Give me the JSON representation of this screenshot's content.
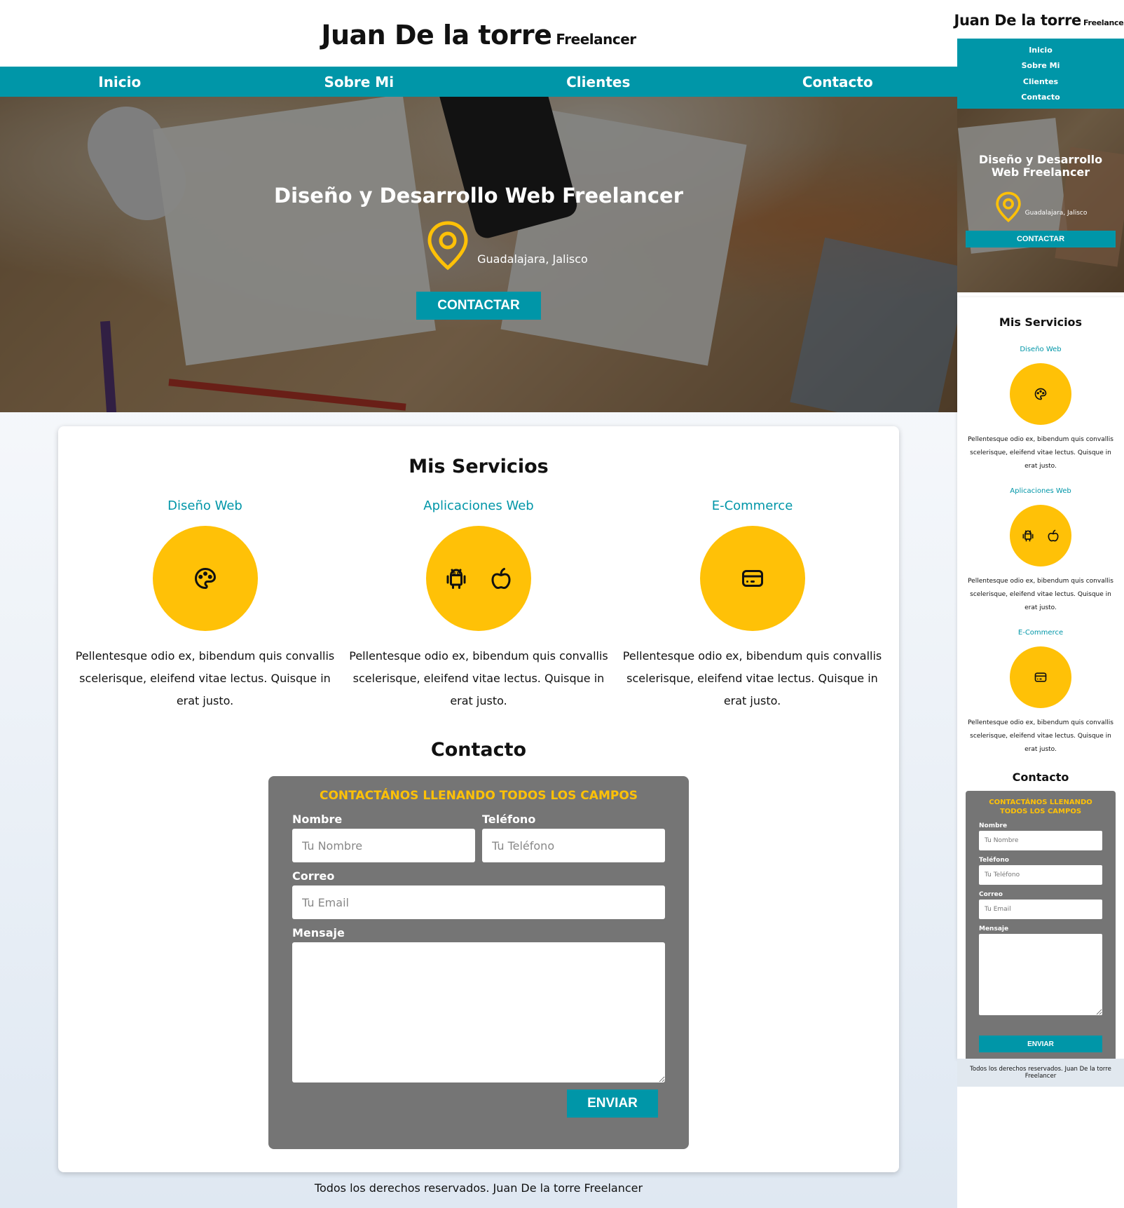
{
  "site": {
    "name": "Juan De la torre",
    "tag": "Freelancer"
  },
  "nav": {
    "items": [
      "Inicio",
      "Sobre Mi",
      "Clientes",
      "Contacto"
    ]
  },
  "hero": {
    "title": "Diseño y Desarrollo Web Freelancer",
    "location": "Guadalajara, Jalisco",
    "cta": "CONTACTAR"
  },
  "services": {
    "title": "Mis Servicios",
    "items": [
      {
        "name": "Diseño Web",
        "icon": "palette-icon",
        "text": "Pellentesque odio ex, bibendum quis convallis scelerisque, eleifend vitae lectus. Quisque in erat justo."
      },
      {
        "name": "Aplicaciones Web",
        "icon": "android-icon apple-icon",
        "text": "Pellentesque odio ex, bibendum quis convallis scelerisque, eleifend vitae lectus. Quisque in erat justo."
      },
      {
        "name": "E-Commerce",
        "icon": "credit-card-icon",
        "text": "Pellentesque odio ex, bibendum quis convallis scelerisque, eleifend vitae lectus. Quisque in erat justo."
      }
    ]
  },
  "contact": {
    "title": "Contacto",
    "form_title": "CONTACTÁNOS LLENANDO TODOS LOS CAMPOS",
    "name_label": "Nombre",
    "name_placeholder": "Tu Nombre",
    "phone_label": "Teléfono",
    "phone_placeholder": "Tu Teléfono",
    "email_label": "Correo",
    "email_placeholder": "Tu Email",
    "message_label": "Mensaje",
    "submit": "ENVIAR"
  },
  "footer": {
    "text": "Todos los derechos reservados. Juan De la torre Freelancer"
  },
  "colors": {
    "accent": "#0096a8",
    "yellow": "#ffc107",
    "form_bg": "#757575"
  }
}
